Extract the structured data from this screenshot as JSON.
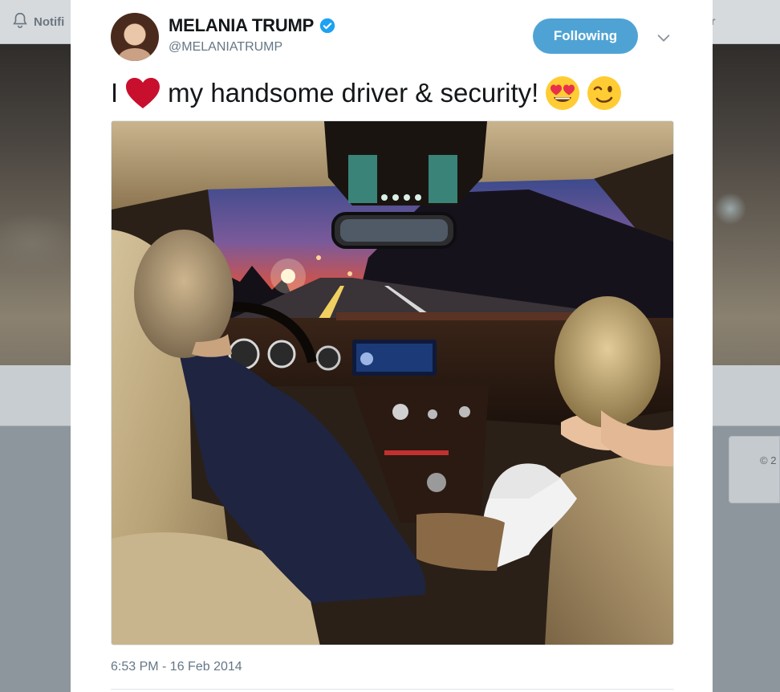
{
  "background": {
    "nav_label": "Notifi",
    "nav_right_fragment": "r",
    "copyright_fragment": "© 2"
  },
  "tweet": {
    "author": {
      "display_name": "MELANIA TRUMP",
      "handle": "@MELANIATRUMP",
      "verified": true
    },
    "follow_button_label": "Following",
    "text_before": "I",
    "text_after": "my handsome driver & security!",
    "emojis": [
      "red-heart",
      "heart-eyes-face",
      "winking-face"
    ],
    "timestamp": "6:53 PM - 16 Feb 2014"
  },
  "colors": {
    "follow_button": "#4fa3d4",
    "verified_badge": "#1da1f2",
    "heart": "#c8102e",
    "text": "#14171a",
    "secondary_text": "#657786",
    "overlay": "#8e969d"
  }
}
